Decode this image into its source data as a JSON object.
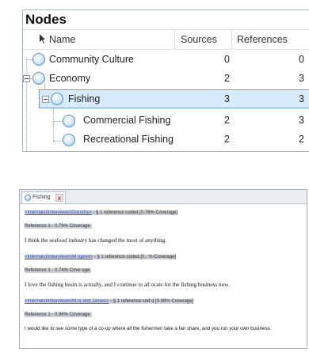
{
  "nodes_panel": {
    "title": "Nodes",
    "columns": {
      "name": "Name",
      "sources": "Sources",
      "references": "References"
    },
    "rows": [
      {
        "name": "Community Culture",
        "sources": "0",
        "references": "0"
      },
      {
        "name": "Economy",
        "sources": "2",
        "references": "3"
      },
      {
        "name": "Fishing",
        "sources": "3",
        "references": "3",
        "selected": true
      },
      {
        "name": "Commercial Fishing",
        "sources": "2",
        "references": "3"
      },
      {
        "name": "Recreational Fishing",
        "sources": "2",
        "references": "2"
      }
    ],
    "selection_color": "#d9eafb"
  },
  "document": {
    "tab": {
      "label": "Fishing",
      "close": "x"
    },
    "entries": [
      {
        "source_link": "<Internals\\\\Interviews\\\\Dorothy>",
        "source_meta": " - § 1 reference coded  [0.76% Coverage]",
        "reference": "Reference 1 - 0.76% Coverage",
        "text": "I think the seafood industry has changed the most of anything."
      },
      {
        "source_link": "<Internals\\\\Interviews\\\\M  rgaret>",
        "source_meta": " - § 1 reference coded  [0.:  % Coverage]",
        "reference": "Reference 1 - 0.74% Cove  age",
        "text": "I love the fishing busin  is actually, and I continue to ad  ocate for the fishing business now."
      },
      {
        "source_link": "<Internals\\\\Interviews\\\\M  ry and James>",
        "source_meta": " - § 1 reference cod  d  [0.96% Coverage]",
        "reference": "Reference 1 - 0.96% Coverage",
        "text": "I would like to see some type of a co-op where all the fishermen take a fair share, and you run your own business."
      }
    ]
  }
}
